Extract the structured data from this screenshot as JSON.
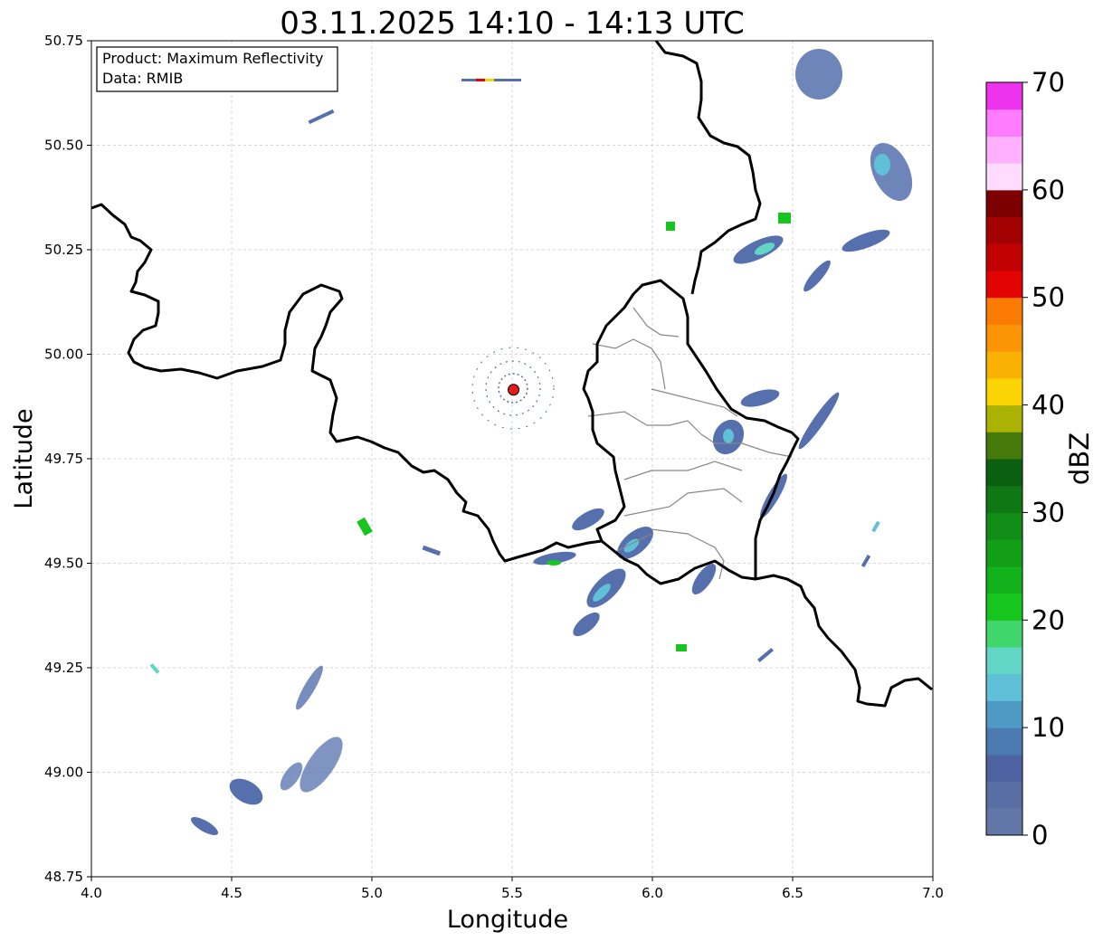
{
  "title": "03.11.2025 14:10 - 14:13 UTC",
  "xlabel": "Longitude",
  "ylabel": "Latitude",
  "info": {
    "product": "Product: Maximum Reflectivity",
    "source": "Data: RMIB"
  },
  "x_ticks": [
    "4.0",
    "4.5",
    "5.0",
    "5.5",
    "6.0",
    "6.5",
    "7.0"
  ],
  "y_ticks": [
    "50.75",
    "50.50",
    "50.25",
    "50.00",
    "49.75",
    "49.50",
    "49.25",
    "49.00",
    "48.75"
  ],
  "colorbar": {
    "label": "dBZ",
    "ticks": [
      "0",
      "10",
      "20",
      "30",
      "40",
      "50",
      "60",
      "70"
    ],
    "colors": [
      "#6276a8",
      "#5a6ea6",
      "#4f63a2",
      "#4c7bb2",
      "#4f9ac4",
      "#5fc0d8",
      "#61d6c6",
      "#40d66b",
      "#17c51f",
      "#13b11b",
      "#129e17",
      "#118c16",
      "#0f7814",
      "#0b5f10",
      "#457a0b",
      "#aab204",
      "#fad503",
      "#fbb103",
      "#fb9503",
      "#fb7b03",
      "#e30303",
      "#c20202",
      "#a40202",
      "#7d0000",
      "#ffdcff",
      "#ffb1ff",
      "#ff7bff",
      "#ee33ee"
    ]
  },
  "radar_site": {
    "lon": 5.505,
    "lat": 49.915,
    "color": "#e31b1b"
  },
  "map_extent": {
    "lon": [
      4.0,
      7.0
    ],
    "lat": [
      48.75,
      50.75
    ]
  },
  "colors": {
    "border": "#000000",
    "subdivision": "#888888",
    "grid": "#c8c8c8"
  }
}
